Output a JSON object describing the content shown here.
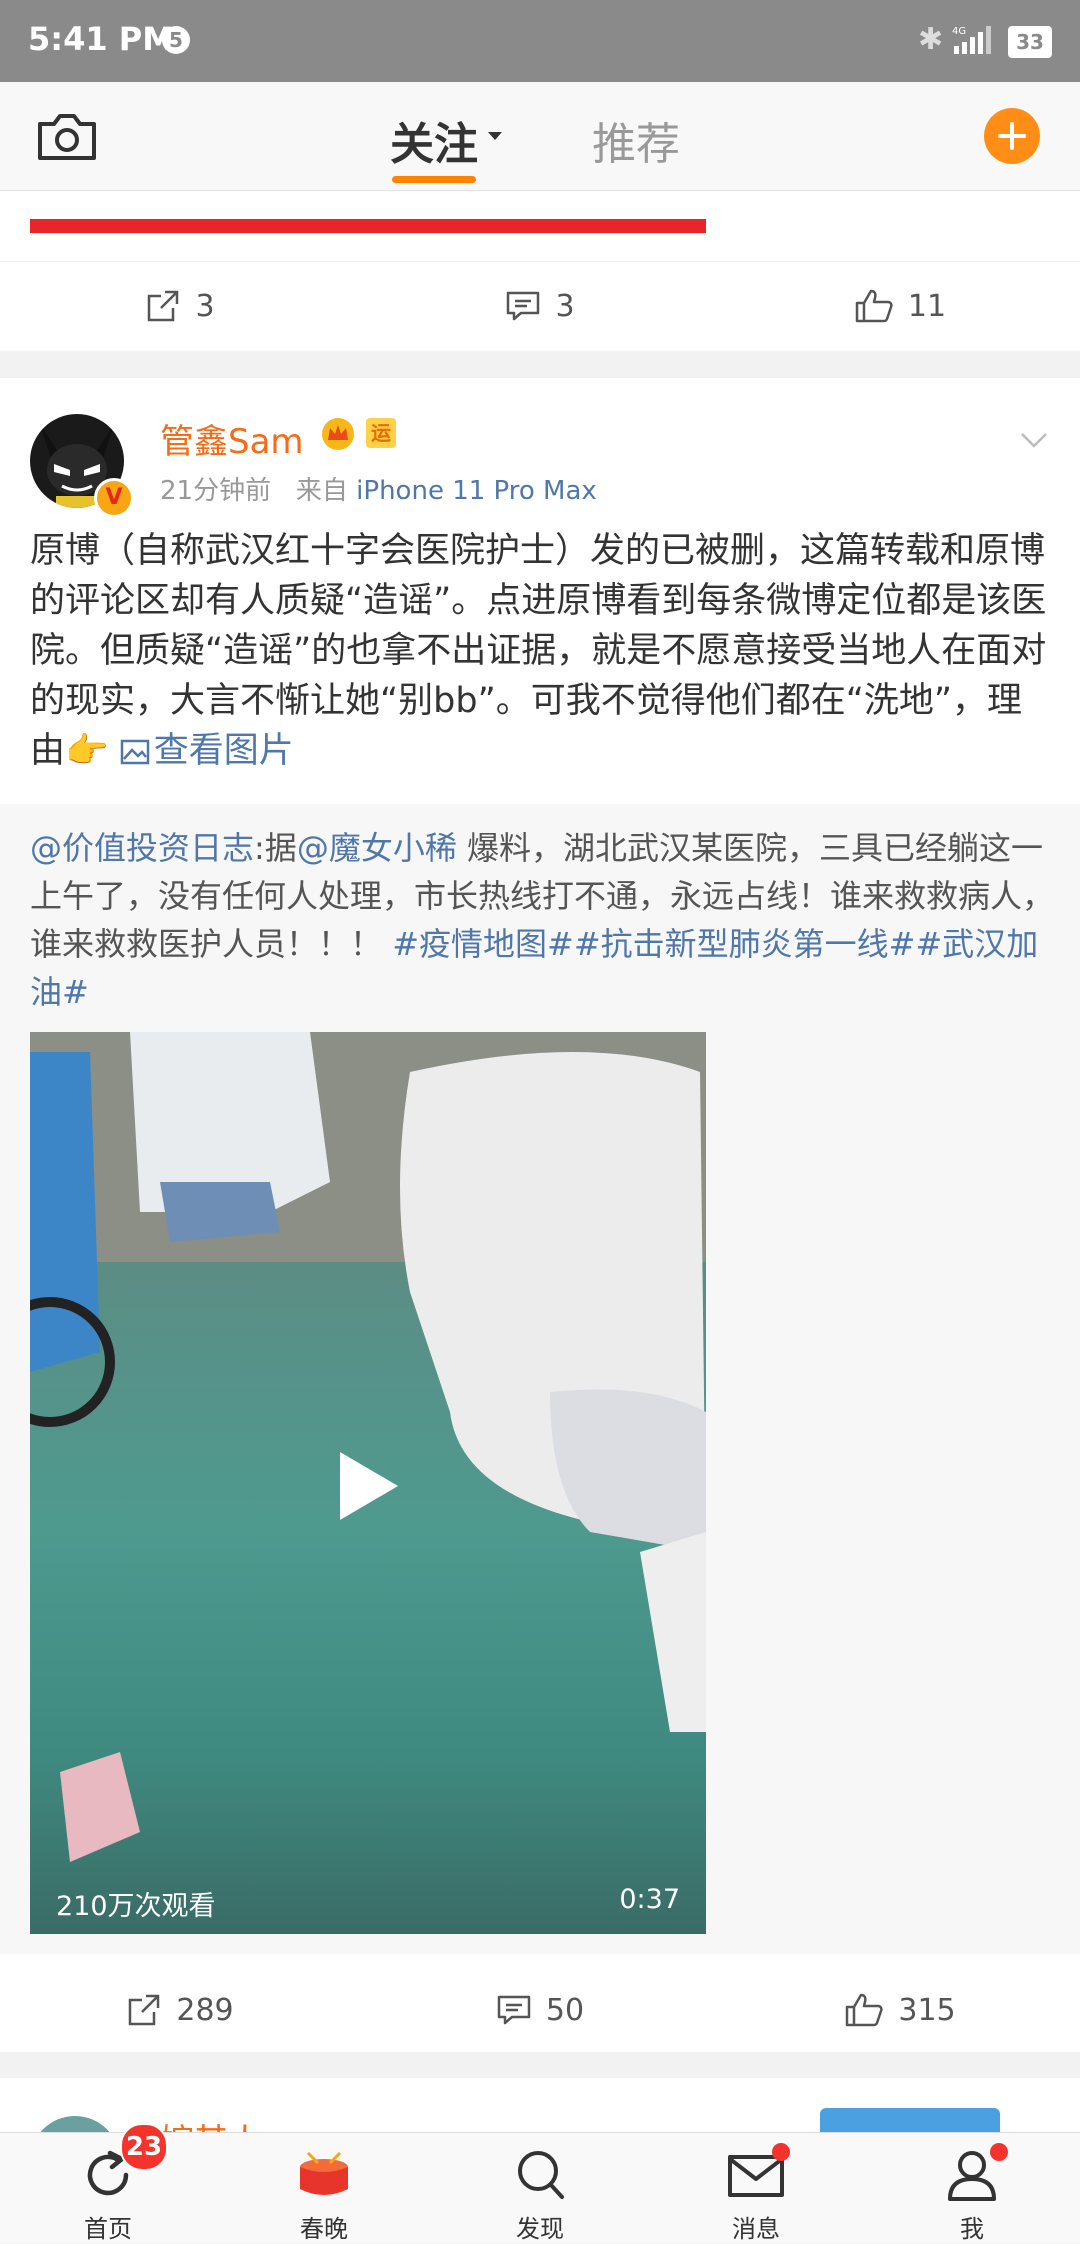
{
  "status_bar": {
    "time": "5:41 PM",
    "notification_count": "5",
    "network": "4G",
    "battery": "33"
  },
  "top_nav": {
    "follow_tab": "关注",
    "recommend_tab": "推荐"
  },
  "prev_card": {
    "repost_count": "3",
    "comment_count": "3",
    "like_count": "11"
  },
  "post": {
    "author": "管鑫Sam",
    "level_badge": "运",
    "time": "21分钟前",
    "from_label": "来自",
    "source": "iPhone 11 Pro Max",
    "text": "原博（自称武汉红十字会医院护士）发的已被删，这篇转载和原博的评论区却有人质疑“造谣”。点进原博看到每条微博定位都是该医院。但质疑“造谣”的也拿不出证据，就是不愿意接受当地人在面对的现实，大言不惭让她“别bb”。可我不觉得他们都在“洗地”，理由👉 ",
    "view_image_link": "查看图片",
    "retweet": {
      "author_mention": "@价值投资日志",
      "prefix": ":据",
      "source_mention": "@魔女小稀",
      "body": " 爆料，湖北武汉某医院，三具已经躺这一上午了，没有任何人处理，市长热线打不通，永远占线！谁来救救病人，谁来救救医护人员！！！ ",
      "hashtags": "#疫情地图##抗击新型肺炎第一线##武汉加油#",
      "video_views": "210万次观看",
      "video_duration": "0:37"
    },
    "repost_count": "289",
    "comment_count": "50",
    "like_count": "315"
  },
  "next_card": {
    "author": "嫁其人"
  },
  "tab_bar": {
    "home": "首页",
    "home_badge": "23",
    "spring_gala": "春晚",
    "discover": "发现",
    "messages": "消息",
    "me": "我"
  },
  "colors": {
    "accent": "#ff8200",
    "link": "#5077aa",
    "author": "#f56b17",
    "badge": "#f5332d"
  }
}
